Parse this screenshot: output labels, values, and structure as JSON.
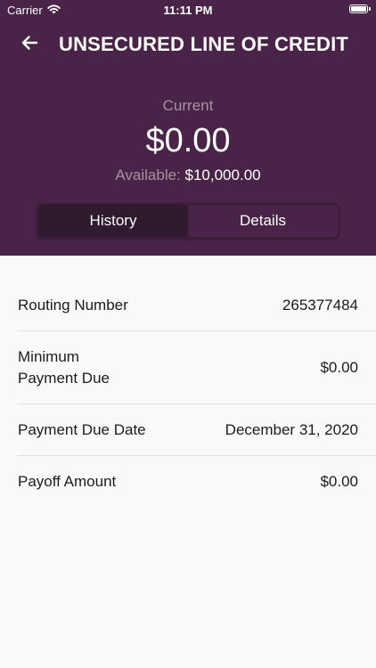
{
  "status_bar": {
    "carrier": "Carrier",
    "time": "11:11 PM",
    "battery_level": 1.0
  },
  "nav": {
    "title": "UNSECURED LINE OF CREDIT"
  },
  "balance": {
    "label": "Current",
    "amount": "$0.00",
    "available_label": "Available:",
    "available_value": "$10,000.00"
  },
  "tabs": [
    {
      "label": "History"
    },
    {
      "label": "Details",
      "selected": true
    }
  ],
  "details": [
    {
      "label": "Routing Number",
      "value": "265377484"
    },
    {
      "label": "Minimum Payment Due",
      "value": "$0.00"
    },
    {
      "label": "Payment Due Date",
      "value": "December 31, 2020"
    },
    {
      "label": "Payoff Amount",
      "value": "$0.00"
    }
  ],
  "colors": {
    "header_background": "#4a2448",
    "page_background": "#f9f9f9",
    "muted_label": "#a8919f"
  }
}
